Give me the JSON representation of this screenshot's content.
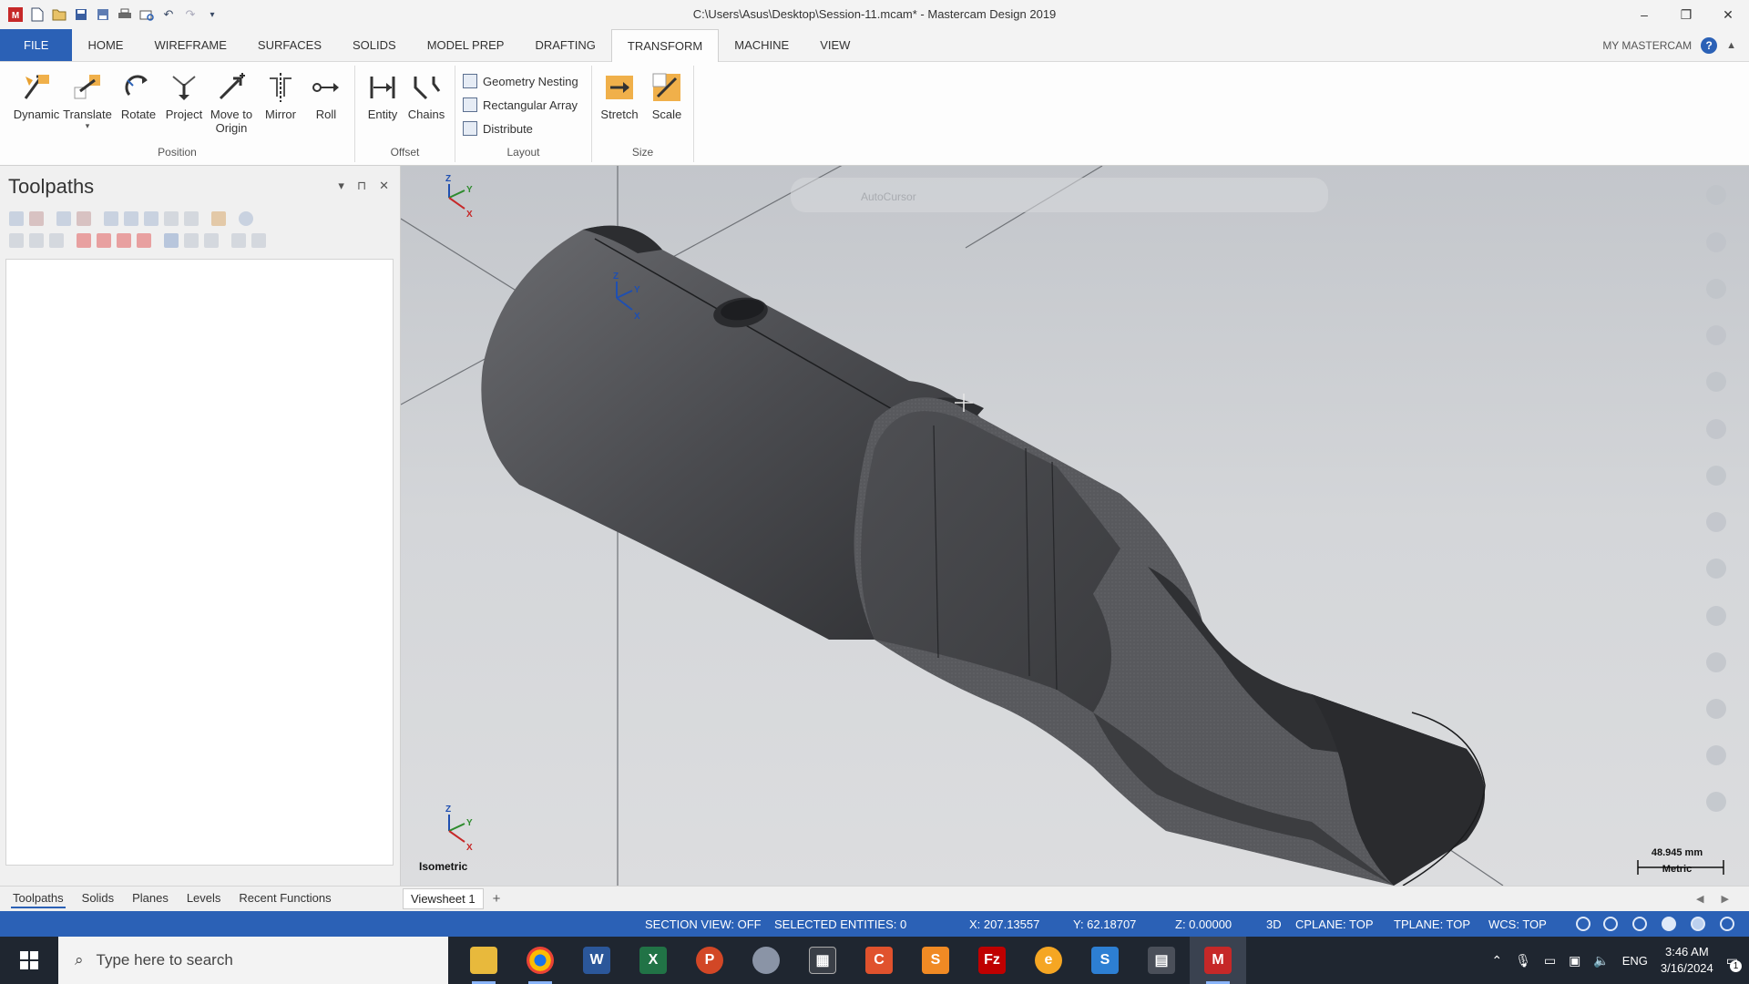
{
  "window": {
    "title": "C:\\Users\\Asus\\Desktop\\Session-11.mcam* - Mastercam Design 2019",
    "minimize": "–",
    "restore": "❐",
    "close": "✕"
  },
  "qat": {
    "new_icon": "new-file-icon",
    "open_icon": "open-icon",
    "save_icon": "save-icon",
    "undo_icon": "undo-icon",
    "redo_icon": "redo-icon"
  },
  "ribbon_tabs": [
    {
      "label": "FILE"
    },
    {
      "label": "HOME"
    },
    {
      "label": "WIREFRAME"
    },
    {
      "label": "SURFACES"
    },
    {
      "label": "SOLIDS"
    },
    {
      "label": "MODEL PREP"
    },
    {
      "label": "DRAFTING"
    },
    {
      "label": "TRANSFORM"
    },
    {
      "label": "MACHINE"
    },
    {
      "label": "VIEW"
    }
  ],
  "active_tab": "TRANSFORM",
  "my_mastercam": "MY MASTERCAM",
  "ribbon": {
    "position": {
      "label": "Position",
      "buttons": [
        {
          "label": "Dynamic"
        },
        {
          "label": "Translate"
        },
        {
          "label": "Rotate"
        },
        {
          "label": "Project"
        },
        {
          "label": "Move to Origin"
        },
        {
          "label": "Mirror"
        },
        {
          "label": "Roll"
        }
      ]
    },
    "offset": {
      "label": "Offset",
      "buttons": [
        {
          "label": "Entity"
        },
        {
          "label": "Chains"
        }
      ]
    },
    "layout": {
      "label": "Layout",
      "buttons": [
        {
          "label": "Geometry Nesting"
        },
        {
          "label": "Rectangular Array"
        },
        {
          "label": "Distribute"
        }
      ]
    },
    "size": {
      "label": "Size",
      "buttons": [
        {
          "label": "Stretch"
        },
        {
          "label": "Scale"
        }
      ]
    }
  },
  "panel": {
    "title": "Toolpaths",
    "dropdown": "▾",
    "pin": "⊓",
    "close": "✕"
  },
  "viewport": {
    "view_name": "Isometric",
    "scale_value": "48.945 mm",
    "scale_units": "Metric",
    "axis_x": "X",
    "axis_y": "Y",
    "axis_z": "Z",
    "autocursor": "AutoCursor"
  },
  "bottom_tabs": [
    {
      "label": "Toolpaths"
    },
    {
      "label": "Solids"
    },
    {
      "label": "Planes"
    },
    {
      "label": "Levels"
    },
    {
      "label": "Recent Functions"
    }
  ],
  "sheet": {
    "label": "Viewsheet 1",
    "add": "+",
    "arrows": "◀ ▶"
  },
  "status": {
    "section_view": "SECTION VIEW: OFF",
    "selected": "SELECTED ENTITIES: 0",
    "x": "X:   207.13557",
    "y": "Y:   62.18707",
    "z": "Z:   0.00000",
    "mode": "3D",
    "cplane": "CPLANE: TOP",
    "tplane": "TPLANE: TOP",
    "wcs": "WCS: TOP"
  },
  "taskbar": {
    "search_placeholder": "Type here to search",
    "language": "ENG",
    "time": "3:46 AM",
    "date": "3/16/2024",
    "notification_count": "1"
  },
  "colors": {
    "accent": "#2b61b6",
    "model_dark": "#3a3b3e",
    "model_mid": "#55575b"
  }
}
